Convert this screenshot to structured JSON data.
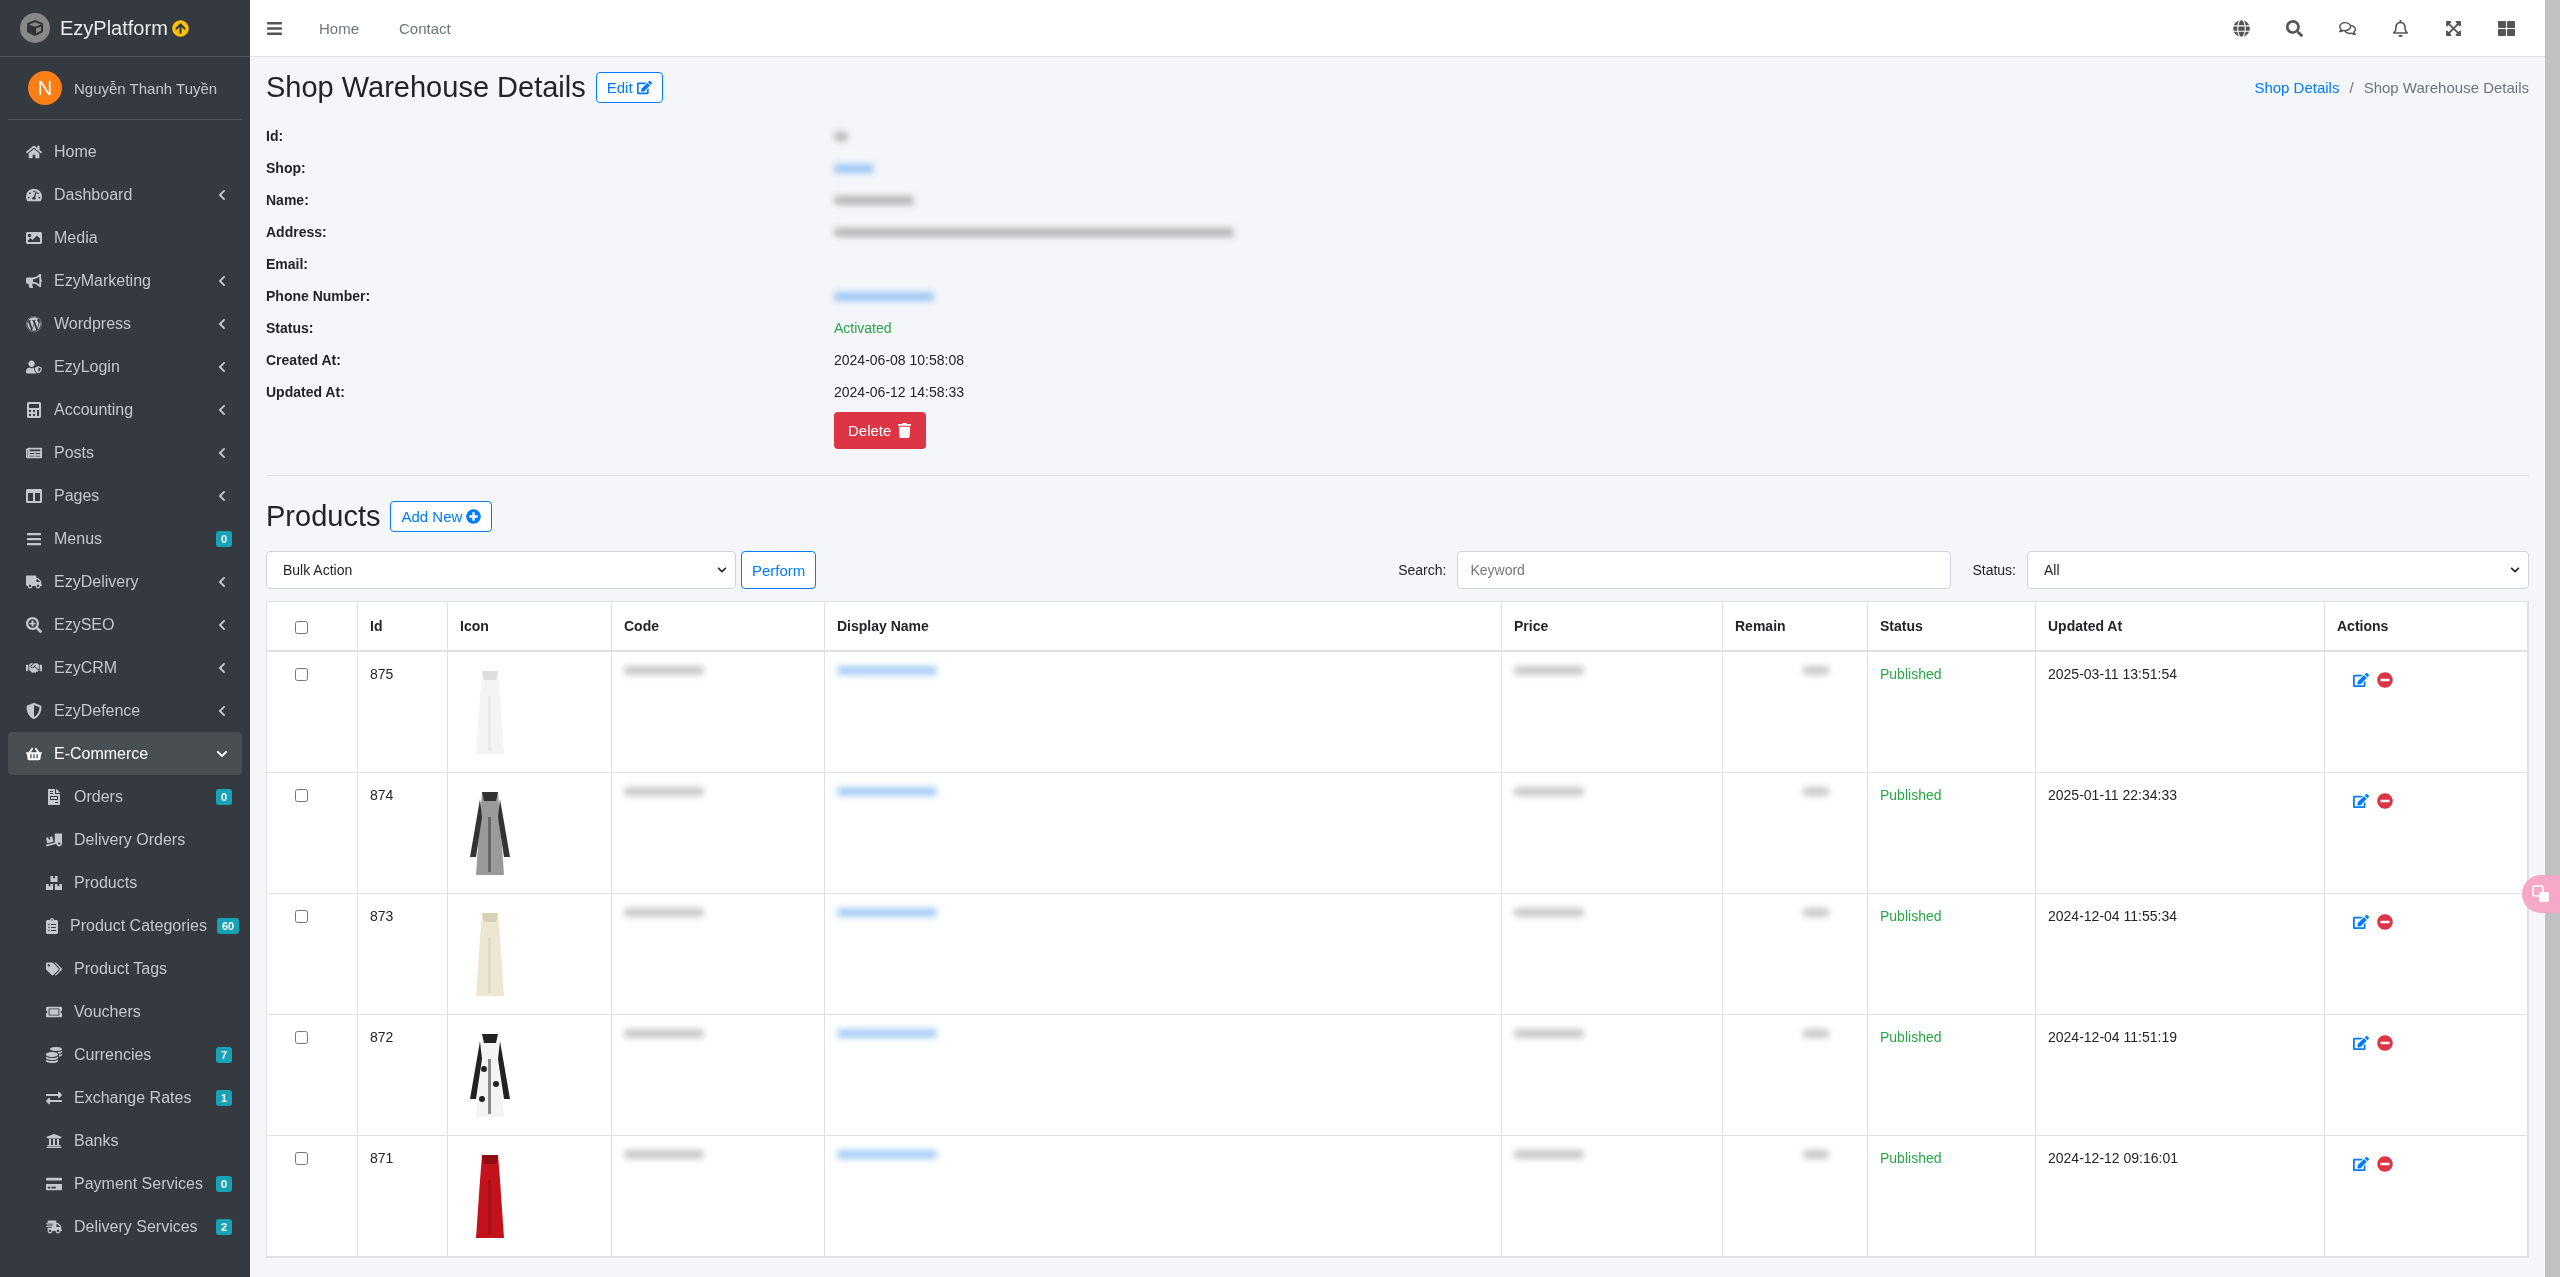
{
  "brand": {
    "name": "EzyPlatform"
  },
  "user": {
    "initial": "N",
    "name": "Nguyễn Thanh Tuyền"
  },
  "sidebar": {
    "items": [
      {
        "label": "Home",
        "selected": false
      },
      {
        "label": "Dashboard",
        "selected": false,
        "expanded": false
      },
      {
        "label": "Media",
        "selected": false
      },
      {
        "label": "EzyMarketing",
        "selected": false,
        "expanded": false
      },
      {
        "label": "Wordpress",
        "selected": false,
        "expanded": false
      },
      {
        "label": "EzyLogin",
        "selected": false,
        "expanded": false
      },
      {
        "label": "Accounting",
        "selected": false,
        "expanded": false
      },
      {
        "label": "Posts",
        "selected": false,
        "expanded": false
      },
      {
        "label": "Pages",
        "selected": false,
        "expanded": false
      },
      {
        "label": "Menus",
        "selected": false,
        "badge": "0"
      },
      {
        "label": "EzyDelivery",
        "selected": false,
        "expanded": false
      },
      {
        "label": "EzySEO",
        "selected": false,
        "expanded": false
      },
      {
        "label": "EzyCRM",
        "selected": false,
        "expanded": false
      },
      {
        "label": "EzyDefence",
        "selected": false,
        "expanded": false
      },
      {
        "label": "E-Commerce",
        "selected": true,
        "expanded": true,
        "children": [
          {
            "label": "Orders",
            "selected": false,
            "badge": "0"
          },
          {
            "label": "Delivery Orders",
            "selected": false
          },
          {
            "label": "Products",
            "selected": false
          },
          {
            "label": "Product Categories",
            "selected": false,
            "badge": "60"
          },
          {
            "label": "Product Tags",
            "selected": false
          },
          {
            "label": "Vouchers",
            "selected": false
          },
          {
            "label": "Currencies",
            "selected": false,
            "badge": "7"
          },
          {
            "label": "Exchange Rates",
            "selected": false,
            "badge": "1"
          },
          {
            "label": "Banks",
            "selected": false
          },
          {
            "label": "Payment Services",
            "selected": false,
            "badge": "0"
          },
          {
            "label": "Delivery Services",
            "selected": false,
            "badge": "2"
          }
        ]
      }
    ]
  },
  "topnav": {
    "links": [
      "Home",
      "Contact"
    ]
  },
  "breadcrumb": [
    {
      "label": "Shop Details",
      "kind": "link"
    },
    {
      "label": "/",
      "kind": "separator"
    },
    {
      "label": "Shop Warehouse Details",
      "kind": "current"
    }
  ],
  "details": {
    "title": "Shop Warehouse Details",
    "edit_button": "Edit",
    "delete_button": "Delete",
    "fields": [
      {
        "label": "Id:",
        "kind": "blurred"
      },
      {
        "label": "Shop:",
        "kind": "blurred_link"
      },
      {
        "label": "Name:",
        "kind": "blurred"
      },
      {
        "label": "Address:",
        "kind": "blurred"
      },
      {
        "label": "Email:",
        "kind": "empty"
      },
      {
        "label": "Phone Number:",
        "kind": "blurred_link"
      },
      {
        "label": "Status:",
        "kind": "status",
        "value": "Activated"
      },
      {
        "label": "Created At:",
        "kind": "text",
        "value": "2024-06-08 10:58:08"
      },
      {
        "label": "Updated At:",
        "kind": "text",
        "value": "2024-06-12 14:58:33"
      }
    ]
  },
  "products": {
    "title": "Products",
    "add_button": "Add New",
    "bulk_action": "Bulk Action",
    "perform_button": "Perform",
    "search_label": "Search:",
    "search_placeholder": "Keyword",
    "status_label": "Status:",
    "status_value": "All",
    "header_checked": false,
    "columns": [
      "Id",
      "Icon",
      "Code",
      "Display Name",
      "Price",
      "Remain",
      "Status",
      "Updated At",
      "Actions"
    ],
    "rows": [
      {
        "checked": false,
        "id": "875",
        "status": "Published",
        "updated_at": "2025-03-11 13:51:54"
      },
      {
        "checked": false,
        "id": "874",
        "status": "Published",
        "updated_at": "2025-01-11 22:34:33"
      },
      {
        "checked": false,
        "id": "873",
        "status": "Published",
        "updated_at": "2024-12-04 11:55:34"
      },
      {
        "checked": false,
        "id": "872",
        "status": "Published",
        "updated_at": "2024-12-04 11:51:19"
      },
      {
        "checked": false,
        "id": "871",
        "status": "Published",
        "updated_at": "2024-12-12 09:16:01"
      }
    ]
  }
}
